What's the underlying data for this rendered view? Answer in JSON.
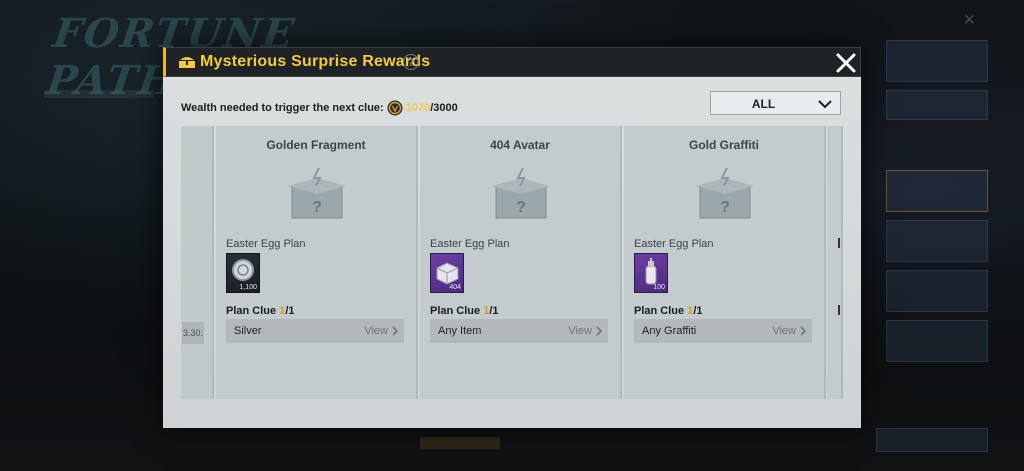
{
  "background": {
    "game_title": "FORTUNE PATHWAY"
  },
  "modal": {
    "title": "Mysterious Surprise Rewards",
    "help_symbol": "?",
    "wealth_label": "Wealth needed to trigger the next clue:",
    "wealth_current": "1070",
    "wealth_total": "/3000",
    "filter": {
      "selected": "ALL"
    },
    "partial_card_date": "3.30.",
    "cards": [
      {
        "name": "Golden Fragment",
        "plan_label": "Easter Egg Plan",
        "icon": "silver-coin-icon",
        "icon_qty": "1,100",
        "clue_label": "Plan Clue",
        "clue_progress": "1",
        "clue_total": "/1",
        "requirement": "Silver",
        "view_label": "View"
      },
      {
        "name": "404 Avatar",
        "plan_label": "Easter Egg Plan",
        "icon": "item-crate-icon",
        "icon_qty": "404",
        "clue_label": "Plan Clue",
        "clue_progress": "1",
        "clue_total": "/1",
        "requirement": "Any Item",
        "view_label": "View"
      },
      {
        "name": "Gold Graffiti",
        "plan_label": "Easter Egg Plan",
        "icon": "spray-can-icon",
        "icon_qty": "100",
        "clue_label": "Plan Clue",
        "clue_progress": "1",
        "clue_total": "/1",
        "requirement": "Any Graffiti",
        "view_label": "View"
      }
    ]
  },
  "colors": {
    "accent": "#f2c94c",
    "header_bg": "#1f2326",
    "card_bg": "#c4cbcd",
    "item_purple": "#6e3fa6"
  }
}
